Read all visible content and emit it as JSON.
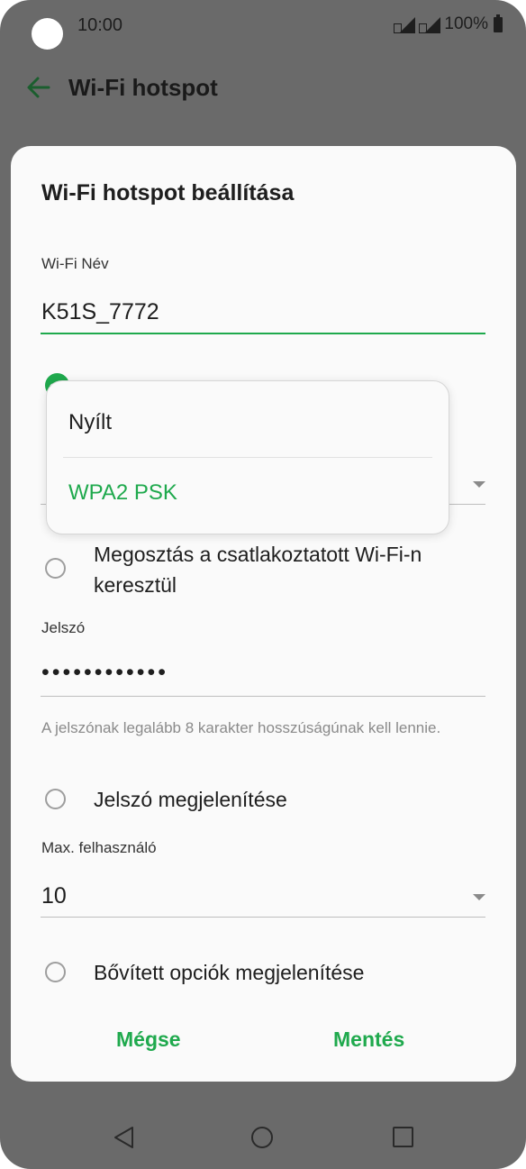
{
  "status_bar": {
    "time": "10:00",
    "battery": "100%"
  },
  "app_bar": {
    "title": "Wi-Fi hotspot"
  },
  "dialog": {
    "title": "Wi-Fi hotspot beállítása",
    "wifi_name": {
      "label": "Wi-Fi Név",
      "value": "K51S_7772"
    },
    "share": {
      "label": "Megosztás a csatlakoztatott Wi-Fi-n keresztül",
      "checked": false
    },
    "password": {
      "label": "Jelszó",
      "value": "••••••••••••",
      "hint": "A jelszónak legalább 8 karakter hosszúságúnak kell lennie."
    },
    "show_password": {
      "label": "Jelszó megjelenítése",
      "checked": false
    },
    "max_users": {
      "label": "Max. felhasználó",
      "value": "10"
    },
    "advanced": {
      "label": "Bővített opciók megjelenítése",
      "checked": false
    },
    "actions": {
      "cancel": "Mégse",
      "save": "Mentés"
    }
  },
  "security_menu": {
    "options": [
      {
        "label": "Nyílt",
        "selected": false
      },
      {
        "label": "WPA2 PSK",
        "selected": true
      }
    ]
  },
  "colors": {
    "accent": "#1fa94d",
    "scrim": "#6a6a6a",
    "dialog_bg": "#fafafa"
  },
  "icons": {
    "back": "arrow-left-icon",
    "nav_back": "triangle-back-icon",
    "nav_home": "circle-home-icon",
    "nav_recent": "square-recent-icon"
  }
}
